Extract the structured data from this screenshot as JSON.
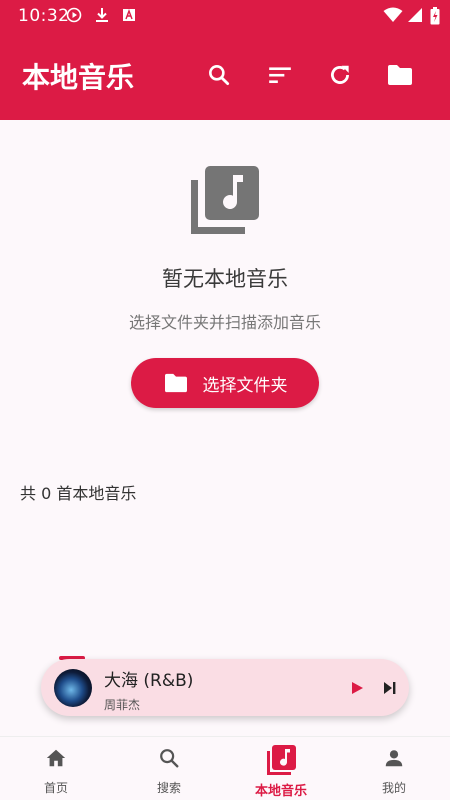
{
  "status_bar": {
    "time": "10:32"
  },
  "app_bar": {
    "title": "本地音乐"
  },
  "empty_state": {
    "title": "暂无本地音乐",
    "subtitle": "选择文件夹并扫描添加音乐",
    "button_label": "选择文件夹"
  },
  "song_count_text": "共 0 首本地音乐",
  "mini_player": {
    "title": "大海 (R&B)",
    "artist": "周菲杰"
  },
  "bottom_nav": {
    "items": [
      {
        "label": "首页",
        "icon": "home-icon"
      },
      {
        "label": "搜索",
        "icon": "search-icon"
      },
      {
        "label": "本地音乐",
        "icon": "library-music-icon"
      },
      {
        "label": "我的",
        "icon": "person-icon"
      }
    ],
    "active_index": 2
  },
  "colors": {
    "primary": "#dc1b45",
    "background": "#fdf8fb",
    "mini_player_bg": "#fadde4"
  }
}
